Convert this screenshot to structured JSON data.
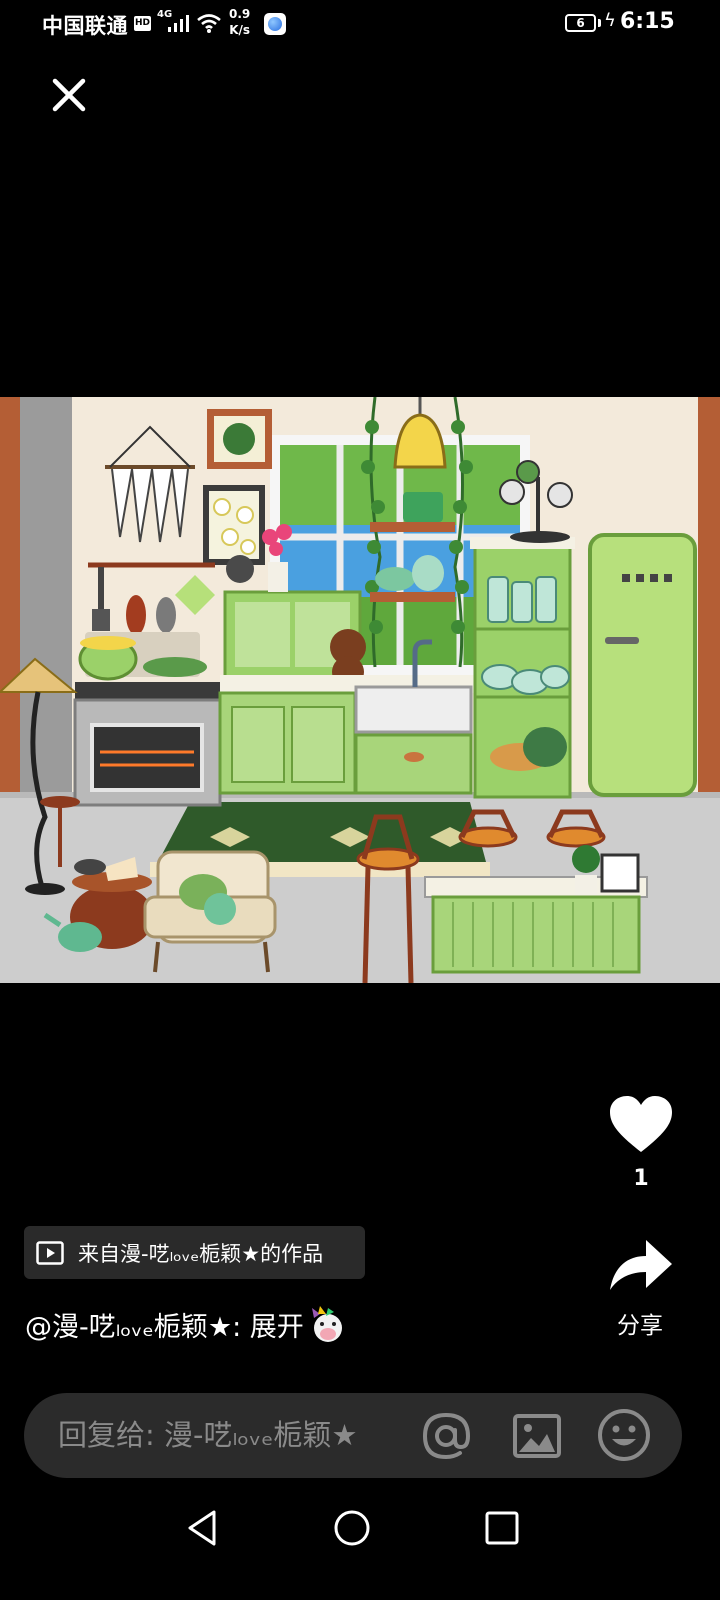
{
  "status_bar": {
    "carrier": "中国联通",
    "hd_badge": "HD",
    "network_type": "4G",
    "speed_value": "0.9",
    "speed_unit": "K/s",
    "battery_level": "6",
    "time": "6:15"
  },
  "icons": {
    "close": "close-icon",
    "like": "heart-icon",
    "share": "share-arrow-icon",
    "play": "play-icon",
    "mention": "at-icon",
    "image": "image-icon",
    "emoji": "emoji-icon",
    "nav_back": "back-triangle-icon",
    "nav_home": "home-circle-icon",
    "nav_recent": "recent-square-icon"
  },
  "post": {
    "like_count": "1",
    "share_label": "分享",
    "source_label": "来自漫-呓ₗₒᵥₑ栀颖★的作品",
    "caption": "@漫-呓ₗₒᵥₑ栀颖★: 展开"
  },
  "reply": {
    "placeholder": "回复给: 漫-呓ₗₒᵥₑ栀颖★"
  },
  "colors": {
    "background": "#000000",
    "chip_background": "#2a2a2a",
    "reply_bar_background": "#2b2b2b",
    "placeholder_text": "#8a8a8a",
    "kitchen_green": "#a8d57a"
  }
}
